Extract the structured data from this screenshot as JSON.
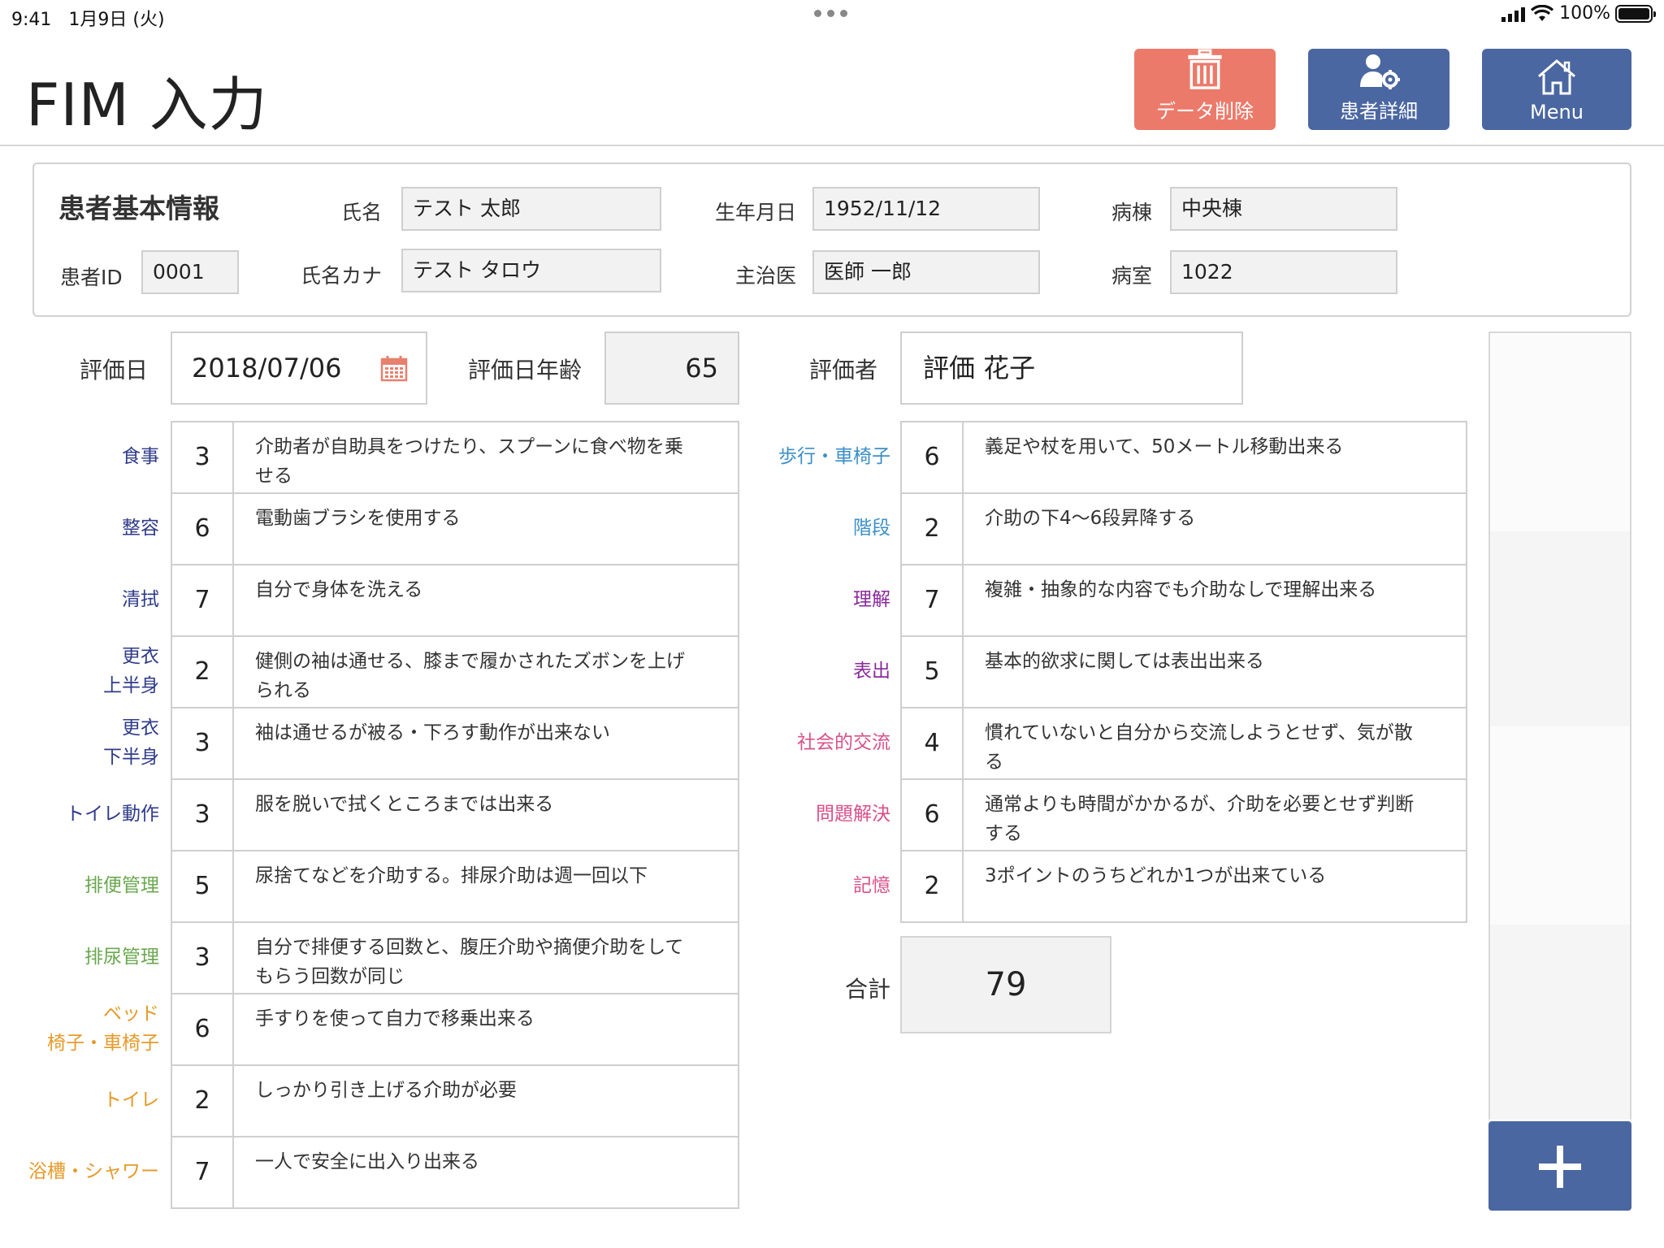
{
  "status": {
    "time": "9:41",
    "date": "1月9日 (火)",
    "battery": "100%"
  },
  "header": {
    "title": "FIM 入力",
    "delete_label": "データ削除",
    "patient_detail_label": "患者詳細",
    "menu_label": "Menu"
  },
  "colors": {
    "delete": "#ec7a6a",
    "primary": "#4b67a1"
  },
  "patient": {
    "section_title": "患者基本情報",
    "id_label": "患者ID",
    "id": "0001",
    "name_label": "氏名",
    "name": "テスト 太郎",
    "kana_label": "氏名カナ",
    "kana": "テスト タロウ",
    "birth_label": "生年月日",
    "birth": "1952/11/12",
    "doctor_label": "主治医",
    "doctor": "医師 一郎",
    "ward_label": "病棟",
    "ward": "中央棟",
    "room_label": "病室",
    "room": "1022"
  },
  "evaluation": {
    "date_label": "評価日",
    "date": "2018/07/06",
    "age_label": "評価日年齢",
    "age": "65",
    "evaluator_label": "評価者",
    "evaluator": "評価 花子"
  },
  "items_left": [
    {
      "label": [
        "食事"
      ],
      "score": "3",
      "desc": [
        "介助者が自助具をつけたり、スプーンに食べ物を乗",
        "せる"
      ],
      "color": "navy"
    },
    {
      "label": [
        "整容"
      ],
      "score": "6",
      "desc": [
        "電動歯ブラシを使用する"
      ],
      "color": "navy"
    },
    {
      "label": [
        "清拭"
      ],
      "score": "7",
      "desc": [
        "自分で身体を洗える"
      ],
      "color": "navy"
    },
    {
      "label": [
        "更衣",
        "上半身"
      ],
      "score": "2",
      "desc": [
        "健側の袖は通せる、膝まで履かされたズボンを上げ",
        "られる"
      ],
      "color": "navy"
    },
    {
      "label": [
        "更衣",
        "下半身"
      ],
      "score": "3",
      "desc": [
        "袖は通せるが被る・下ろす動作が出来ない"
      ],
      "color": "navy"
    },
    {
      "label": [
        "トイレ動作"
      ],
      "score": "3",
      "desc": [
        "服を脱いで拭くところまでは出来る"
      ],
      "color": "navy"
    },
    {
      "label": [
        "排便管理"
      ],
      "score": "5",
      "desc": [
        "尿捨てなどを介助する。排尿介助は週一回以下"
      ],
      "color": "green"
    },
    {
      "label": [
        "排尿管理"
      ],
      "score": "3",
      "desc": [
        "自分で排便する回数と、腹圧介助や摘便介助をして",
        "もらう回数が同じ"
      ],
      "color": "green"
    },
    {
      "label": [
        "ベッド",
        "椅子・車椅子"
      ],
      "score": "6",
      "desc": [
        "手すりを使って自力で移乗出来る"
      ],
      "color": "orange"
    },
    {
      "label": [
        "トイレ"
      ],
      "score": "2",
      "desc": [
        "しっかり引き上げる介助が必要"
      ],
      "color": "orange"
    },
    {
      "label": [
        "浴槽・シャワー"
      ],
      "score": "7",
      "desc": [
        "一人で安全に出入り出来る"
      ],
      "color": "orange"
    }
  ],
  "items_right": [
    {
      "label": [
        "歩行・車椅子"
      ],
      "score": "6",
      "desc": [
        "義足や杖を用いて、50メートル移動出来る"
      ],
      "color": "blue"
    },
    {
      "label": [
        "階段"
      ],
      "score": "2",
      "desc": [
        "介助の下4〜6段昇降する"
      ],
      "color": "blue"
    },
    {
      "label": [
        "理解"
      ],
      "score": "7",
      "desc": [
        "複雑・抽象的な内容でも介助なしで理解出来る"
      ],
      "color": "purple"
    },
    {
      "label": [
        "表出"
      ],
      "score": "5",
      "desc": [
        "基本的欲求に関しては表出出来る"
      ],
      "color": "purple"
    },
    {
      "label": [
        "社会的交流"
      ],
      "score": "4",
      "desc": [
        "慣れていないと自分から交流しようとせず、気が散",
        "る"
      ],
      "color": "pink"
    },
    {
      "label": [
        "問題解決"
      ],
      "score": "6",
      "desc": [
        "通常よりも時間がかかるが、介助を必要とせず判断",
        "する"
      ],
      "color": "pink"
    },
    {
      "label": [
        "記憶"
      ],
      "score": "2",
      "desc": [
        "3ポイントのうちどれか1つが出来ている"
      ],
      "color": "pink"
    }
  ],
  "total": {
    "label": "合計",
    "value": "79"
  },
  "icons": {
    "delete": "trash-icon",
    "patient": "user-gear-icon",
    "menu": "home-icon",
    "calendar": "calendar-icon",
    "add": "plus-icon"
  }
}
